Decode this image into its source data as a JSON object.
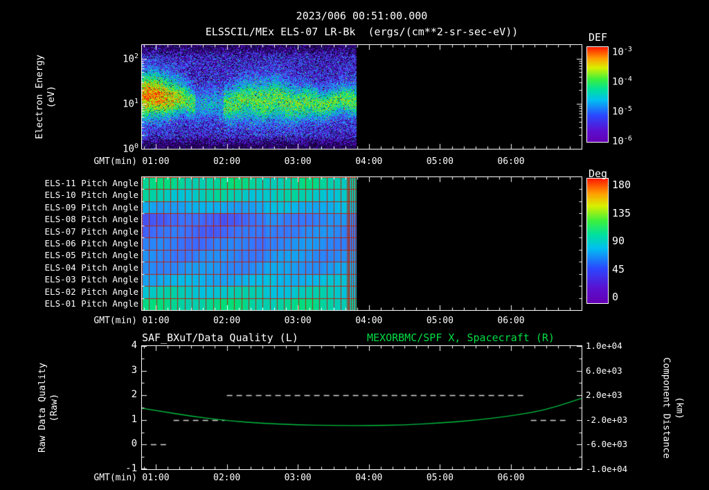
{
  "header": {
    "title": "2023/006 00:51:00.000",
    "subtitle": "ELSSCIL/MEx ELS-07 LR-Bk  (ergs/(cm**2-sr-sec-eV))"
  },
  "axes": {
    "gmt_label": "GMT(min)",
    "x_tick_labels": [
      "01:00",
      "02:00",
      "03:00",
      "04:00",
      "05:00",
      "06:00"
    ]
  },
  "panel1": {
    "ylabel_line1": "Electron Energy",
    "ylabel_line2": "(eV)",
    "ytick_base": "10",
    "ytick_exponents": [
      "2",
      "1",
      "0"
    ],
    "colorbar": {
      "title": "DEF",
      "tick_base": "10",
      "tick_exponents": [
        "-3",
        "-4",
        "-5",
        "-6"
      ]
    }
  },
  "panel2": {
    "row_labels": [
      "ELS-11 Pitch Angle",
      "ELS-10 Pitch Angle",
      "ELS-09 Pitch Angle",
      "ELS-08 Pitch Angle",
      "ELS-07 Pitch Angle",
      "ELS-06 Pitch Angle",
      "ELS-05 Pitch Angle",
      "ELS-04 Pitch Angle",
      "ELS-03 Pitch Angle",
      "ELS-02 Pitch Angle",
      "ELS-01 Pitch Angle"
    ],
    "colorbar": {
      "title": "Deg",
      "ticks": [
        "180",
        "135",
        "90",
        "45",
        "0"
      ]
    }
  },
  "panel3": {
    "title_left": "SAF_BXuT/Data Quality (L)",
    "title_right": "MEXORBMC/SPF X, Spacecraft (R)",
    "ylabel_left_line1": "Raw Data Quality",
    "ylabel_left_line2": "(Raw)",
    "ylabel_right_line1": "Component Distance",
    "ylabel_right_line2": "(km)",
    "yticks_left": [
      "4",
      "3",
      "2",
      "1",
      "0",
      "-1"
    ],
    "yticks_right": [
      "1.0e+04",
      "6.0e+03",
      "2.0e+03",
      "-2.0e+03",
      "-6.0e+03",
      "-1.0e+04"
    ]
  },
  "colors": {
    "background": "#000000",
    "text": "#ffffff",
    "accent_green": "#00dd44",
    "curve_green": "#00bf40",
    "grid_red": "#b42410",
    "quality_dash": "#dcdcdc"
  },
  "chart_data": [
    {
      "type": "heatmap",
      "name": "electron-energy-spectrogram",
      "title": "ELSSCIL/MEx ELS-07 LR-Bk",
      "units": "ergs/(cm**2-sr-sec-eV)",
      "xlabel": "GMT(min)",
      "x_ticks": [
        "01:00",
        "02:00",
        "03:00",
        "04:00",
        "05:00",
        "06:00"
      ],
      "x_range_hours": [
        0.805,
        6.99
      ],
      "data_end_hour": 3.83,
      "ylabel": "Electron Energy (eV)",
      "y_scale": "log",
      "y_range_ev": [
        1,
        200
      ],
      "value_scale": "log",
      "value_range": [
        1e-06,
        0.001
      ],
      "colorbar_title": "DEF",
      "features": {
        "background_log_flux": -5.5,
        "noise_amplitude": 0.6,
        "band_center_ev": 11,
        "band_sigma_decades": 0.28,
        "band_peak_log_flux": -4.1,
        "band_gap_hours": [
          1.55,
          1.95
        ],
        "onset_end_hour": 1.5,
        "onset_center_ev": 22,
        "onset_peak_log_flux": -3.55
      }
    },
    {
      "type": "heatmap",
      "name": "pitch-angle-panels",
      "rows": [
        "ELS-11",
        "ELS-10",
        "ELS-09",
        "ELS-08",
        "ELS-07",
        "ELS-06",
        "ELS-05",
        "ELS-04",
        "ELS-03",
        "ELS-02",
        "ELS-01"
      ],
      "value_units": "degrees",
      "value_range": [
        0,
        180
      ],
      "colorbar_title": "Deg",
      "x_range_hours": [
        0.805,
        6.99
      ],
      "data_end_hour": 3.83,
      "grid_minutes": 6,
      "segments": [
        {
          "from_hour": 0.805,
          "to_hour": 2.55,
          "pitch_angles": [
            96,
            90,
            74,
            52,
            54,
            58,
            62,
            66,
            76,
            88,
            97
          ]
        },
        {
          "from_hour": 2.55,
          "to_hour": 3.83,
          "pitch_angles": [
            95,
            89,
            78,
            62,
            63,
            65,
            67,
            70,
            80,
            88,
            96
          ]
        }
      ]
    },
    {
      "type": "line",
      "name": "data-quality-and-spacecraft-distance",
      "x_range_hours": [
        0.805,
        6.99
      ],
      "left_axis": {
        "label": "Raw Data Quality (Raw)",
        "range": [
          -1,
          4
        ]
      },
      "right_axis": {
        "label": "Component Distance (km)",
        "range": [
          -10000,
          10000
        ]
      },
      "series": [
        {
          "name": "SAF_BXuT/Data Quality (L)",
          "axis": "left",
          "style": "dashed",
          "segments": [
            {
              "value": 0,
              "from_hour": 0.93,
              "to_hour": 1.17
            },
            {
              "value": 1,
              "from_hour": 1.25,
              "to_hour": 1.97
            },
            {
              "value": 2,
              "from_hour": 2.0,
              "to_hour": 6.22
            },
            {
              "value": 1,
              "from_hour": 6.28,
              "to_hour": 6.82
            }
          ]
        },
        {
          "name": "MEXORBMC/SPF X, Spacecraft (R)",
          "axis": "right",
          "style": "solid",
          "points_hour_km": [
            [
              0.805,
              -100
            ],
            [
              1.0,
              -450
            ],
            [
              1.5,
              -1400
            ],
            [
              2.0,
              -2100
            ],
            [
              2.5,
              -2550
            ],
            [
              3.0,
              -2800
            ],
            [
              3.5,
              -2900
            ],
            [
              4.0,
              -2920
            ],
            [
              4.5,
              -2800
            ],
            [
              5.0,
              -2500
            ],
            [
              5.5,
              -2050
            ],
            [
              6.0,
              -1350
            ],
            [
              6.5,
              -350
            ],
            [
              6.99,
              1500
            ]
          ]
        }
      ]
    }
  ]
}
